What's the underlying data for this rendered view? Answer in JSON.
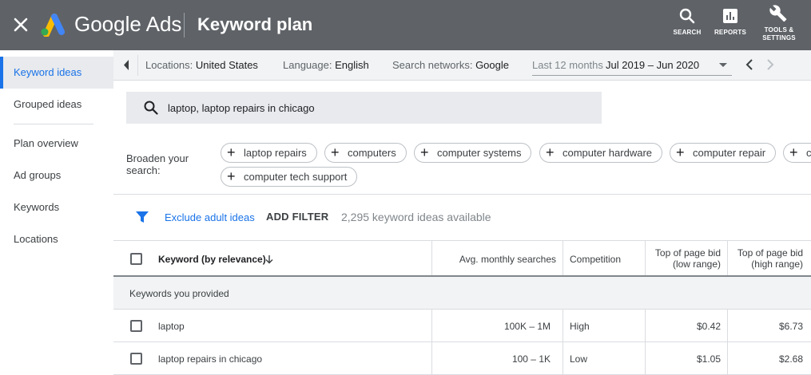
{
  "header": {
    "brand": "Google Ads",
    "page_title": "Keyword plan",
    "actions": [
      {
        "label": "SEARCH",
        "icon": "search-icon"
      },
      {
        "label": "REPORTS",
        "icon": "reports-icon"
      },
      {
        "label_line1": "TOOLS &",
        "label_line2": "SETTINGS",
        "icon": "wrench-icon"
      }
    ]
  },
  "sidebar": {
    "items": [
      {
        "label": "Keyword ideas",
        "active": true
      },
      {
        "label": "Grouped ideas"
      },
      {
        "label": "Plan overview"
      },
      {
        "label": "Ad groups"
      },
      {
        "label": "Keywords"
      },
      {
        "label": "Locations"
      }
    ]
  },
  "filters": {
    "locations_label": "Locations:",
    "locations_value": "United States",
    "language_label": "Language:",
    "language_value": "English",
    "networks_label": "Search networks:",
    "networks_value": "Google",
    "date_label": "Last 12 months",
    "date_value": "Jul 2019 – Jun 2020"
  },
  "search": {
    "query": "laptop, laptop repairs in chicago"
  },
  "broaden": {
    "label_line1": "Broaden your",
    "label_line2": "search:",
    "chips": [
      "laptop repairs",
      "computers",
      "computer systems",
      "computer hardware",
      "computer repair",
      "c",
      "computer tech support"
    ]
  },
  "toolbar": {
    "exclude_label": "Exclude adult ideas",
    "add_filter_label": "ADD FILTER",
    "ideas_count": "2,295 keyword ideas available"
  },
  "table": {
    "headers": {
      "keyword": "Keyword (by relevance)",
      "avg_searches": "Avg. monthly searches",
      "competition": "Competition",
      "bid_low_line1": "Top of page bid",
      "bid_low_line2": "(low range)",
      "bid_high_line1": "Top of page bid",
      "bid_high_line2": "(high range)"
    },
    "group_label": "Keywords you provided",
    "rows": [
      {
        "keyword": "laptop",
        "avg_searches": "100K – 1M",
        "competition": "High",
        "bid_low": "$0.42",
        "bid_high": "$6.73"
      },
      {
        "keyword": "laptop repairs in chicago",
        "avg_searches": "100 – 1K",
        "competition": "Low",
        "bid_low": "$1.05",
        "bid_high": "$2.68"
      }
    ]
  },
  "colors": {
    "header_bg": "#5f6368",
    "accent": "#1a73e8",
    "ads_blue": "#4285f4",
    "ads_yellow": "#fbbc04",
    "ads_green": "#34a853"
  }
}
